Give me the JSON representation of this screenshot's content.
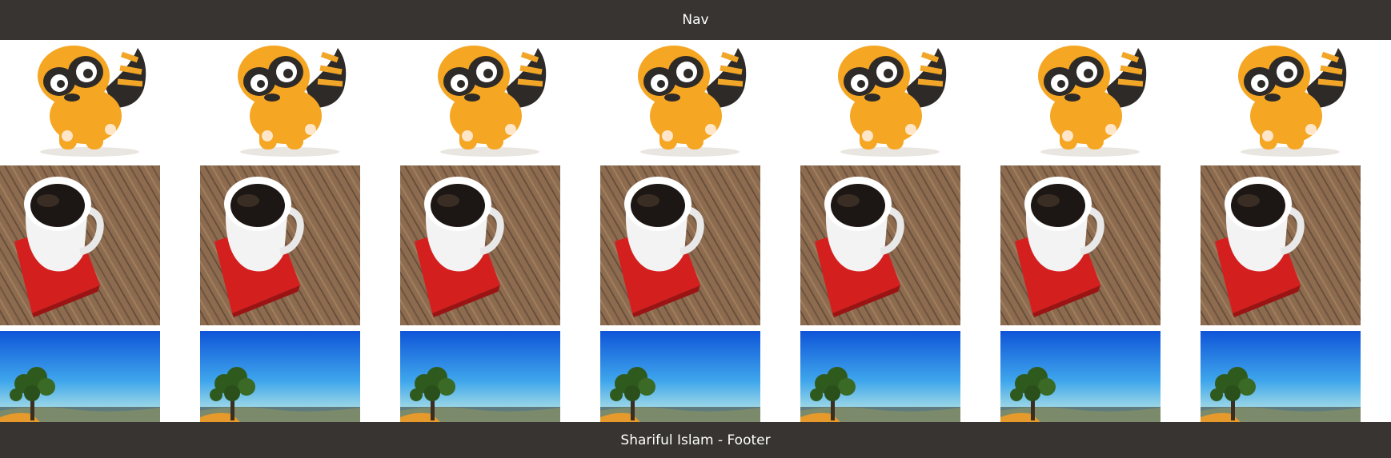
{
  "nav": {
    "label": "Nav"
  },
  "footer": {
    "label": "Shariful Islam - Footer"
  },
  "gallery": {
    "columns": 7,
    "rows": [
      {
        "subject": "orange striped toy mascot"
      },
      {
        "subject": "coffee cup on red saucer on wooden table"
      },
      {
        "subject": "tree against blue sky landscape"
      }
    ]
  },
  "colors": {
    "bar_background": "#373431",
    "bar_text": "#ffffff",
    "page_background": "#ffffff"
  }
}
